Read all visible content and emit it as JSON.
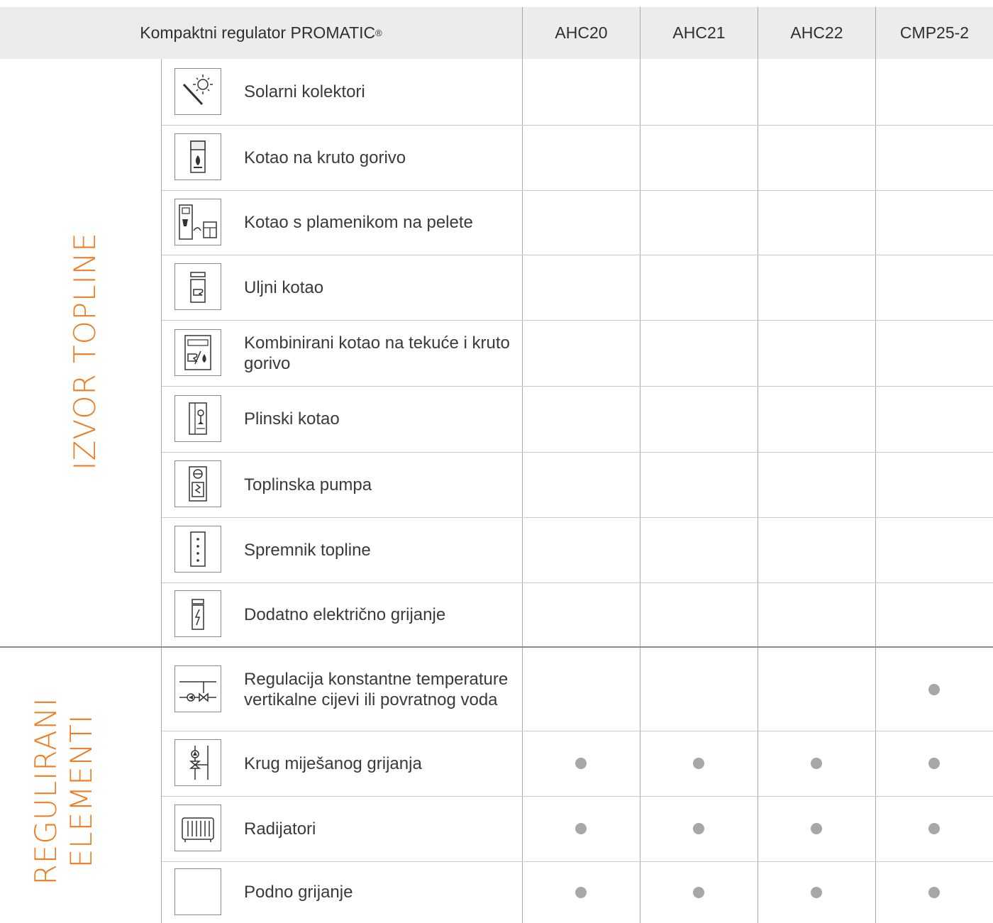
{
  "header": {
    "title": "Kompaktni regulator PROMATIC",
    "title_mark": "®",
    "models": [
      "AHC20",
      "AHC21",
      "AHC22",
      "CMP25-2"
    ]
  },
  "sections": {
    "heat_source": "IZVOR TOPLINE",
    "controlled_elements_line1": "REGULIRANI",
    "controlled_elements_line2": "ELEMENTI"
  },
  "rows": [
    {
      "label": "Solarni kolektori",
      "icon": "solar-collector-icon",
      "supported": [
        false,
        false,
        false,
        false
      ]
    },
    {
      "label": "Kotao na kruto gorivo",
      "icon": "solid-fuel-boiler-icon",
      "supported": [
        false,
        false,
        false,
        false
      ]
    },
    {
      "label": "Kotao s plamenikom na pelete",
      "icon": "pellet-boiler-icon",
      "supported": [
        false,
        false,
        false,
        false
      ]
    },
    {
      "label": "Uljni kotao",
      "icon": "oil-boiler-icon",
      "supported": [
        false,
        false,
        false,
        false
      ]
    },
    {
      "label": "Kombinirani kotao na tekuće i kruto gorivo",
      "icon": "combined-boiler-icon",
      "supported": [
        false,
        false,
        false,
        false
      ]
    },
    {
      "label": "Plinski kotao",
      "icon": "gas-boiler-icon",
      "supported": [
        false,
        false,
        false,
        false
      ]
    },
    {
      "label": "Toplinska pumpa",
      "icon": "heat-pump-icon",
      "supported": [
        false,
        false,
        false,
        false
      ]
    },
    {
      "label": "Spremnik topline",
      "icon": "heat-storage-icon",
      "supported": [
        false,
        false,
        false,
        false
      ]
    },
    {
      "label": "Dodatno električno grijanje",
      "icon": "electric-heater-icon",
      "supported": [
        false,
        false,
        false,
        false
      ]
    },
    {
      "label": "Regulacija konstantne temperature vertikalne cijevi ili povratnog voda",
      "icon": "constant-temperature-icon",
      "supported": [
        false,
        false,
        false,
        true
      ]
    },
    {
      "label": "Krug miješanog grijanja",
      "icon": "mixing-circuit-icon",
      "supported": [
        true,
        true,
        true,
        true
      ]
    },
    {
      "label": "Radijatori",
      "icon": "radiator-icon",
      "supported": [
        true,
        true,
        true,
        true
      ]
    },
    {
      "label": "Podno grijanje",
      "icon": "floor-heating-icon",
      "supported": [
        true,
        true,
        true,
        true
      ]
    }
  ],
  "colors": {
    "accent": "#f07c22",
    "header_bg": "#ececec",
    "dot": "#a7a7a7"
  }
}
